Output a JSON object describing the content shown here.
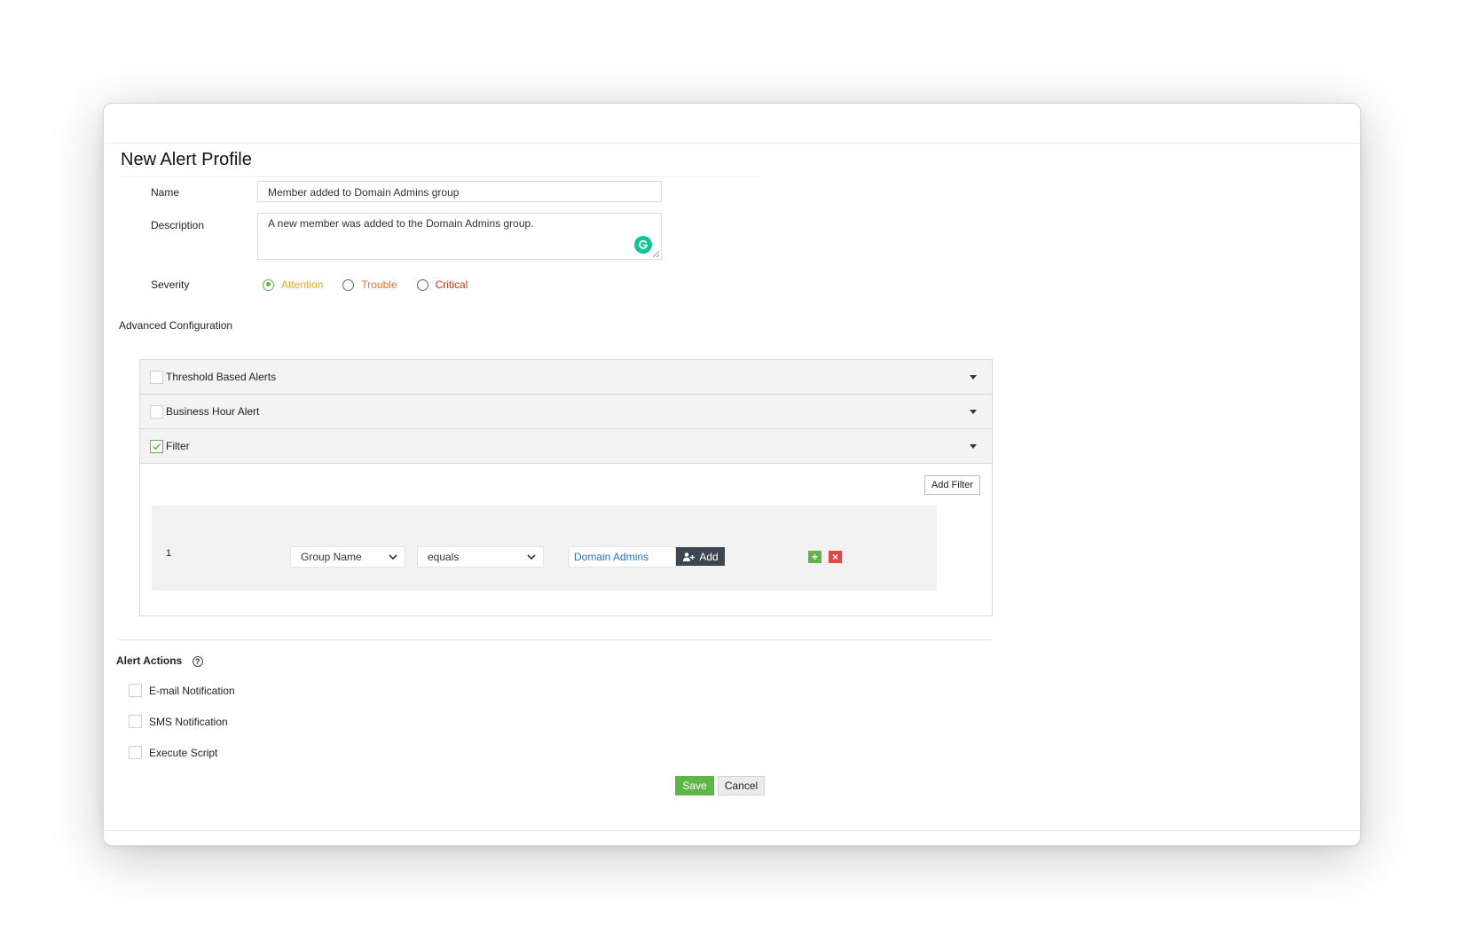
{
  "page": {
    "title": "New Alert Profile"
  },
  "form": {
    "name_label": "Name",
    "name_value": "Member added to Domain Admins group",
    "description_label": "Description",
    "description_value": "A new member was added to the Domain Admins group.",
    "severity_label": "Severity",
    "severity_options": [
      {
        "label": "Attention",
        "color": "#e6a817",
        "selected": true
      },
      {
        "label": "Trouble",
        "color": "#e8702a",
        "selected": false
      },
      {
        "label": "Critical",
        "color": "#d9301f",
        "selected": false
      }
    ]
  },
  "advanced": {
    "title": "Advanced Configuration",
    "sections": [
      {
        "label": "Threshold Based Alerts",
        "checked": false
      },
      {
        "label": "Business Hour Alert",
        "checked": false
      },
      {
        "label": "Filter",
        "checked": true
      }
    ],
    "add_filter_label": "Add Filter",
    "filter_rows": [
      {
        "index": "1",
        "field": "Group Name",
        "operator": "equals",
        "value": "Domain Admins",
        "add_label": "Add"
      }
    ]
  },
  "alert_actions": {
    "title": "Alert Actions",
    "help_icon": "question-circle-icon",
    "options": [
      {
        "label": "E-mail Notification",
        "checked": false
      },
      {
        "label": "SMS Notification",
        "checked": false
      },
      {
        "label": "Execute Script",
        "checked": false
      }
    ]
  },
  "buttons": {
    "save": "Save",
    "cancel": "Cancel"
  },
  "colors": {
    "accent_green": "#5fb548",
    "remove_red": "#e04848",
    "link_blue": "#2c6fb7",
    "dark_button": "#3c4650",
    "grammarly": "#15c39a"
  }
}
